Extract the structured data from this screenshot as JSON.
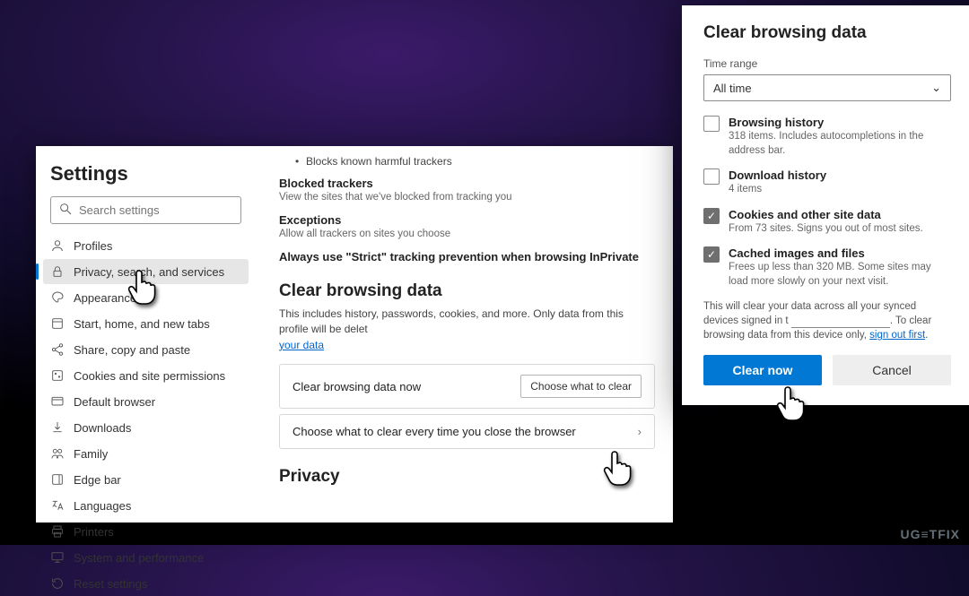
{
  "sidebar": {
    "title": "Settings",
    "search_placeholder": "Search settings",
    "items": [
      {
        "label": "Profiles",
        "icon": "profiles-icon"
      },
      {
        "label": "Privacy, search, and services",
        "icon": "lock-icon"
      },
      {
        "label": "Appearance",
        "icon": "appearance-icon"
      },
      {
        "label": "Start, home, and new tabs",
        "icon": "start-icon"
      },
      {
        "label": "Share, copy and paste",
        "icon": "share-icon"
      },
      {
        "label": "Cookies and site permissions",
        "icon": "cookies-icon"
      },
      {
        "label": "Default browser",
        "icon": "default-browser-icon"
      },
      {
        "label": "Downloads",
        "icon": "downloads-icon"
      },
      {
        "label": "Family",
        "icon": "family-icon"
      },
      {
        "label": "Edge bar",
        "icon": "edge-bar-icon"
      },
      {
        "label": "Languages",
        "icon": "languages-icon"
      },
      {
        "label": "Printers",
        "icon": "printers-icon"
      },
      {
        "label": "System and performance",
        "icon": "system-icon"
      },
      {
        "label": "Reset settings",
        "icon": "reset-icon"
      }
    ]
  },
  "content": {
    "bullet": "Blocks known harmful trackers",
    "blocked": {
      "title": "Blocked trackers",
      "desc": "View the sites that we've blocked from tracking you"
    },
    "exceptions": {
      "title": "Exceptions",
      "desc": "Allow all trackers on sites you choose"
    },
    "strict": "Always use \"Strict\" tracking prevention when browsing InPrivate",
    "cbd_heading": "Clear browsing data",
    "cbd_desc_a": "This includes history, passwords, cookies, and more. Only data from this profile will be delet",
    "cbd_link": "your data",
    "row1_label": "Clear browsing data now",
    "row1_btn": "Choose what to clear",
    "row2_label": "Choose what to clear every time you close the browser",
    "privacy_heading": "Privacy"
  },
  "dialog": {
    "title": "Clear browsing data",
    "time_label": "Time range",
    "time_value": "All time",
    "items": [
      {
        "checked": false,
        "name": "browsing-history",
        "title": "Browsing history",
        "sub": "318 items. Includes autocompletions in the address bar."
      },
      {
        "checked": false,
        "name": "download-history",
        "title": "Download history",
        "sub": "4 items"
      },
      {
        "checked": true,
        "name": "cookies",
        "title": "Cookies and other site data",
        "sub": "From 73 sites. Signs you out of most sites."
      },
      {
        "checked": true,
        "name": "cached",
        "title": "Cached images and files",
        "sub": "Frees up less than 320 MB. Some sites may load more slowly on your next visit."
      }
    ],
    "sync_a": "This will clear your data across all your synced devices signed in t",
    "sync_b": ". To clear browsing data from this device only, ",
    "sync_link": "sign out first",
    "btn_primary": "Clear now",
    "btn_secondary": "Cancel"
  },
  "watermark": "UG≡TFIX"
}
